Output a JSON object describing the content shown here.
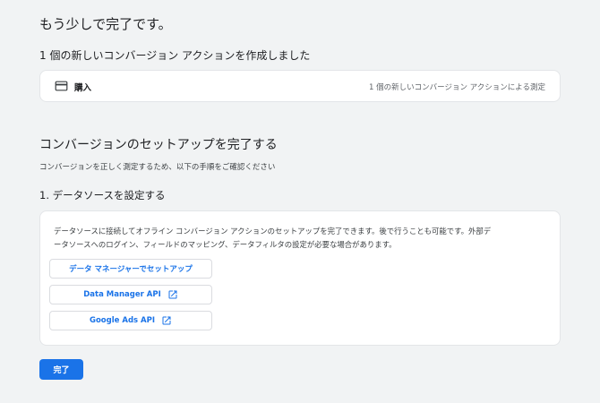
{
  "header": {
    "title": "もう少しで完了です。",
    "created_text": "1 個の新しいコンバージョン アクションを作成しました"
  },
  "conversion_card": {
    "icon": "credit-card-icon",
    "name": "購入",
    "measure_text": "1 個の新しいコンバージョン アクションによる測定"
  },
  "setup": {
    "title": "コンバージョンのセットアップを完了する",
    "description": "コンバージョンを正しく測定するため、以下の手順をご確認ください",
    "step1_title": "1. データソースを設定する",
    "step1_desc_line1": "データソースに接続してオフライン コンバージョン アクションのセットアップを完了できます。後で行うことも可能です。外部デ",
    "step1_desc_line2": "ータソースへのログイン、フィールドのマッピング、データフィルタの設定が必要な場合があります。",
    "buttons": [
      {
        "label": "データ マネージャーでセットアップ",
        "external": false
      },
      {
        "label": "Data Manager API",
        "external": true,
        "icon": "open-in-new-icon"
      },
      {
        "label": "Google Ads API",
        "external": true,
        "icon": "open-in-new-icon"
      }
    ]
  },
  "footer": {
    "done_label": "完了"
  },
  "colors": {
    "accent": "#1a73e8",
    "background": "#f1f3f4",
    "card": "#ffffff",
    "border": "#dadce0"
  }
}
